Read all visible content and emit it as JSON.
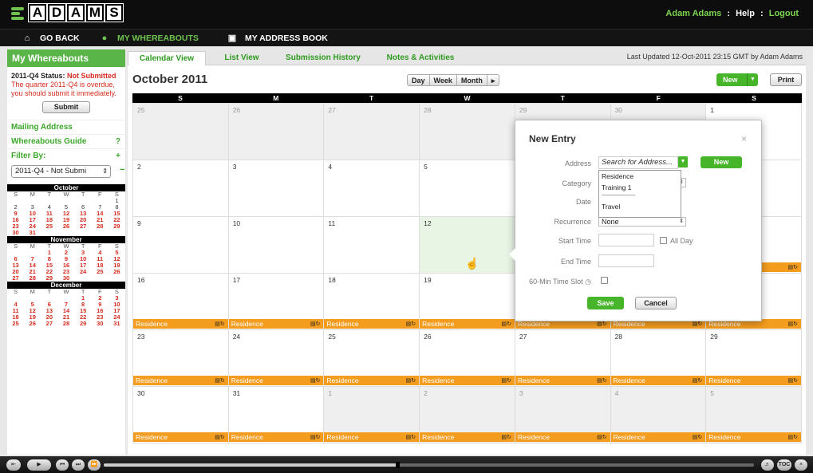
{
  "app": {
    "logo_letters": [
      "A",
      "D",
      "A",
      "M",
      "S"
    ]
  },
  "top_links": {
    "user": "Adam Adams",
    "sep1": ":",
    "help": "Help",
    "sep2": ":",
    "logout": "Logout"
  },
  "nav": {
    "go_back": "GO BACK",
    "my_whereabouts": "MY WHEREABOUTS",
    "address_book": "MY ADDRESS BOOK"
  },
  "sidebar": {
    "title": "My Whereabouts",
    "status_label": "2011-Q4 Status:",
    "status_value": "Not Submitted",
    "overdue_msg": "The quarter 2011-Q4 is overdue, you should submit it immediately.",
    "submit": "Submit",
    "mailing_address": "Mailing Address",
    "guide": "Whereabouts Guide",
    "guide_icon": "?",
    "filter_by": "Filter By:",
    "filter_plus": "+",
    "filter_select": "2011-Q4 - Not Submi",
    "filter_minus": "−",
    "dow": [
      "S",
      "M",
      "T",
      "W",
      "T",
      "F",
      "S"
    ],
    "months": [
      {
        "name": "October",
        "rows": [
          [
            "",
            "",
            "",
            "",
            "",
            "",
            "1"
          ],
          [
            "2",
            "3",
            "4",
            "5",
            "6",
            "7",
            "8"
          ],
          [
            "9",
            "10",
            "11",
            "12",
            "13",
            "14",
            "15"
          ],
          [
            "16",
            "17",
            "18",
            "19",
            "20",
            "21",
            "22"
          ],
          [
            "23",
            "24",
            "25",
            "26",
            "27",
            "28",
            "29"
          ],
          [
            "30",
            "31",
            "",
            "",
            "",
            "",
            ""
          ]
        ]
      },
      {
        "name": "November",
        "rows": [
          [
            "",
            "",
            "1",
            "2",
            "3",
            "4",
            "5"
          ],
          [
            "6",
            "7",
            "8",
            "9",
            "10",
            "11",
            "12"
          ],
          [
            "13",
            "14",
            "15",
            "16",
            "17",
            "18",
            "19"
          ],
          [
            "20",
            "21",
            "22",
            "23",
            "24",
            "25",
            "26"
          ],
          [
            "27",
            "28",
            "29",
            "30",
            "",
            "",
            ""
          ]
        ]
      },
      {
        "name": "December",
        "rows": [
          [
            "",
            "",
            "",
            "",
            "1",
            "2",
            "3"
          ],
          [
            "4",
            "5",
            "6",
            "7",
            "8",
            "9",
            "10"
          ],
          [
            "11",
            "12",
            "13",
            "14",
            "15",
            "16",
            "17"
          ],
          [
            "18",
            "19",
            "20",
            "21",
            "22",
            "23",
            "24"
          ],
          [
            "25",
            "26",
            "27",
            "28",
            "29",
            "30",
            "31"
          ]
        ]
      }
    ]
  },
  "tabs": [
    "Calendar View",
    "List View",
    "Submission History",
    "Notes & Activities"
  ],
  "last_updated": "Last Updated 12-Oct-2011 23:15 GMT by Adam Adams",
  "calendar": {
    "title": "October 2011",
    "views": [
      "Day",
      "Week",
      "Month",
      "▸"
    ],
    "new_btn": "New",
    "print_btn": "Print",
    "dow": [
      "S",
      "M",
      "T",
      "W",
      "T",
      "F",
      "S"
    ],
    "cells": [
      {
        "n": "25",
        "other": true
      },
      {
        "n": "26",
        "other": true
      },
      {
        "n": "27",
        "other": true
      },
      {
        "n": "28",
        "other": true
      },
      {
        "n": "29",
        "other": true
      },
      {
        "n": "30",
        "other": true
      },
      {
        "n": "1"
      },
      {
        "n": "2"
      },
      {
        "n": "3"
      },
      {
        "n": "4"
      },
      {
        "n": "5"
      },
      {
        "n": "6"
      },
      {
        "n": "7"
      },
      {
        "n": "8"
      },
      {
        "n": "9"
      },
      {
        "n": "10"
      },
      {
        "n": "11"
      },
      {
        "n": "12",
        "today": true
      },
      {
        "n": "13"
      },
      {
        "n": "14"
      },
      {
        "n": "15",
        "ev": "Residence"
      },
      {
        "n": "16",
        "ev": "Residence"
      },
      {
        "n": "17",
        "ev": "Residence"
      },
      {
        "n": "18",
        "ev": "Residence"
      },
      {
        "n": "19",
        "ev": "Residence"
      },
      {
        "n": "20",
        "ev": "Residence"
      },
      {
        "n": "21",
        "ev": "Residence"
      },
      {
        "n": "22",
        "ev": "Residence"
      },
      {
        "n": "23",
        "ev": "Residence"
      },
      {
        "n": "24",
        "ev": "Residence"
      },
      {
        "n": "25",
        "ev": "Residence"
      },
      {
        "n": "26",
        "ev": "Residence"
      },
      {
        "n": "27",
        "ev": "Residence"
      },
      {
        "n": "28",
        "ev": "Residence"
      },
      {
        "n": "29",
        "ev": "Residence"
      },
      {
        "n": "30",
        "ev": "Residence"
      },
      {
        "n": "31",
        "ev": "Residence"
      },
      {
        "n": "1",
        "other": true,
        "ev": "Residence"
      },
      {
        "n": "2",
        "other": true,
        "ev": "Residence"
      },
      {
        "n": "3",
        "other": true,
        "ev": "Residence"
      },
      {
        "n": "4",
        "other": true,
        "ev": "Residence"
      },
      {
        "n": "5",
        "other": true,
        "ev": "Residence"
      }
    ]
  },
  "popup": {
    "title": "New Entry",
    "close": "×",
    "address_label": "Address",
    "address_placeholder": "Search for Address...",
    "address_new": "New",
    "category_label": "Category",
    "date_label": "Date",
    "recurrence_label": "Recurrence",
    "recurrence_value": "None",
    "start_label": "Start Time",
    "all_day": "All Day",
    "end_label": "End Time",
    "slot_label": "60-Min Time Slot",
    "save": "Save",
    "cancel": "Cancel",
    "dropdown": [
      "Residence",
      "Training 1",
      "-----------------------",
      "Travel"
    ]
  },
  "player": {
    "toc": "TOC"
  },
  "colors": {
    "green": "#46b52a",
    "orange": "#f39c1e",
    "red": "#d62b1f"
  }
}
